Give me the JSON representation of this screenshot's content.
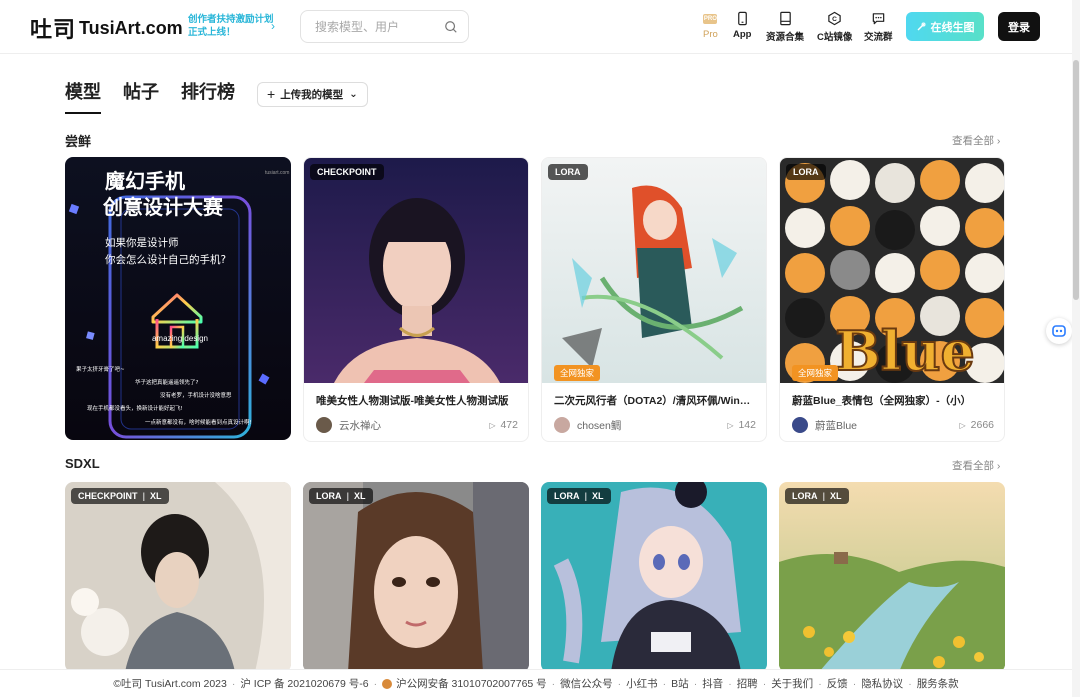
{
  "header": {
    "logo_mark": "吐司",
    "logo_text": "TusiArt.com",
    "promo_line1": "创作者扶持激励计划",
    "promo_line2": "正式上线！",
    "search_placeholder": "搜索模型、用户",
    "nav": [
      {
        "label": "Pro",
        "icon": "pro-icon"
      },
      {
        "label": "App",
        "icon": "phone-icon"
      },
      {
        "label": "资源合集",
        "icon": "book-icon"
      },
      {
        "label": "C站镜像",
        "icon": "hexagon-icon"
      },
      {
        "label": "交流群",
        "icon": "chat-icon"
      }
    ],
    "online_btn": "在线生图",
    "login_btn": "登录"
  },
  "tabs": [
    {
      "label": "模型",
      "active": true
    },
    {
      "label": "帖子",
      "active": false
    },
    {
      "label": "排行榜",
      "active": false
    }
  ],
  "upload_label": "上传我的模型",
  "sections": [
    {
      "title": "尝鲜",
      "see_all": "查看全部",
      "cards": [
        {
          "tags": [],
          "poster_title1": "魔幻手机",
          "poster_title2": "创意设计大赛",
          "poster_sub1": "如果你是设计师",
          "poster_sub2": "你会怎么设计自己的手机?",
          "poster_caption": "amazing  design",
          "poster_site": "tusiart.com",
          "poster_bubbles": [
            "果子太挤牙膏了吧~",
            "华子这把真能遥遥领先了?",
            "没有老罗，手机设计没啥意思",
            "现在手机都没看头，换新设计能好起飞!",
            "一点新意都没有，啥时候能看到点真设计啊!"
          ]
        },
        {
          "tags": [
            "CHECKPOINT"
          ],
          "title": "唯美女性人物测试版-唯美女性人物测试版",
          "author": "云水禅心",
          "count": "472"
        },
        {
          "tags": [
            "LORA"
          ],
          "exclusive": "全网独家",
          "title": "二次元风行者（DOTA2）/清风环佩/Windranger",
          "author": "chosen鲷",
          "count": "142"
        },
        {
          "tags": [
            "LORA"
          ],
          "exclusive": "全网独家",
          "overlay_text": "Blue",
          "title": "蔚蓝Blue_表情包（全网独家）-（小）",
          "author": "蔚蓝Blue",
          "count": "2666"
        }
      ]
    },
    {
      "title": "SDXL",
      "see_all": "查看全部",
      "cards": [
        {
          "tags": [
            "CHECKPOINT",
            "XL"
          ]
        },
        {
          "tags": [
            "LORA",
            "XL"
          ]
        },
        {
          "tags": [
            "LORA",
            "XL"
          ]
        },
        {
          "tags": [
            "LORA",
            "XL"
          ]
        }
      ]
    }
  ],
  "footer": [
    "©吐司 TusiArt.com 2023",
    "沪 ICP 备 2021020679 号-6",
    "沪公网安备 31010702007765 号",
    "微信公众号",
    "小红书",
    "B站",
    "抖音",
    "招聘",
    "关于我们",
    "反馈",
    "隐私协议",
    "服务条款"
  ],
  "colors": {
    "accent": "#4fd8f0",
    "exclusive": "#f29322",
    "promo": "#29b6d8"
  }
}
